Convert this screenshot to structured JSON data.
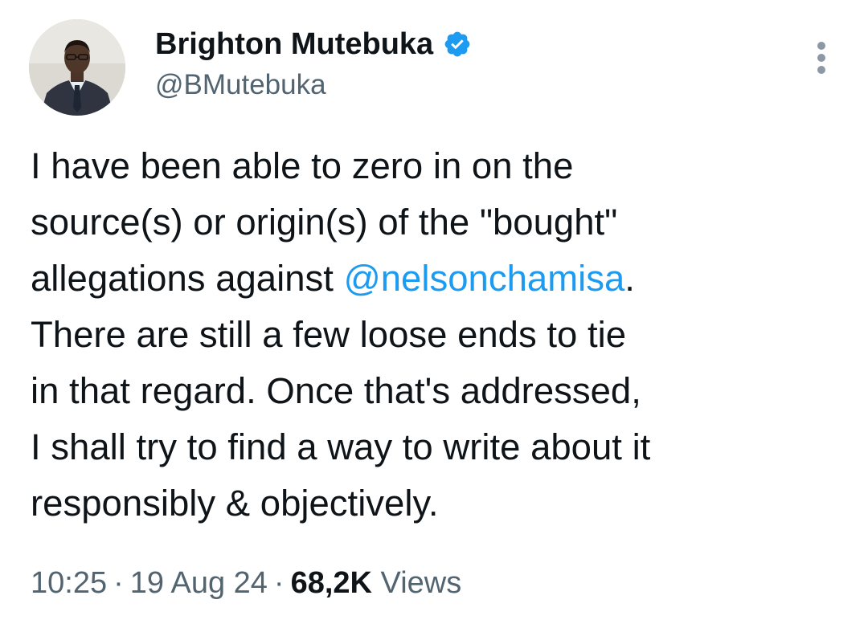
{
  "author": {
    "display_name": "Brighton Mutebuka",
    "handle": "@BMutebuka",
    "verified": true,
    "verified_color": "#1d9bf0"
  },
  "tweet": {
    "lines": [
      [
        "I have been able to zero in on the"
      ],
      [
        "source(s) or origin(s) of the \"bought\""
      ],
      [
        "allegations against ",
        "@nelsonchamisa",
        "."
      ],
      [
        "There are still a few loose ends to tie"
      ],
      [
        "in that regard. Once that's addressed,"
      ],
      [
        "I shall try to find a way to write about it"
      ],
      [
        "responsibly & objectively."
      ]
    ],
    "mention": "@nelsonchamisa"
  },
  "meta": {
    "time": "10:25",
    "separator": "·",
    "date": "19 Aug 24",
    "views_count": "68,2K",
    "views_label": "Views"
  },
  "icons": {
    "more": "more-vertical-icon",
    "verified": "verified-badge-icon"
  },
  "colors": {
    "text": "#0f1419",
    "secondary": "#536471",
    "link": "#1d9bf0"
  }
}
